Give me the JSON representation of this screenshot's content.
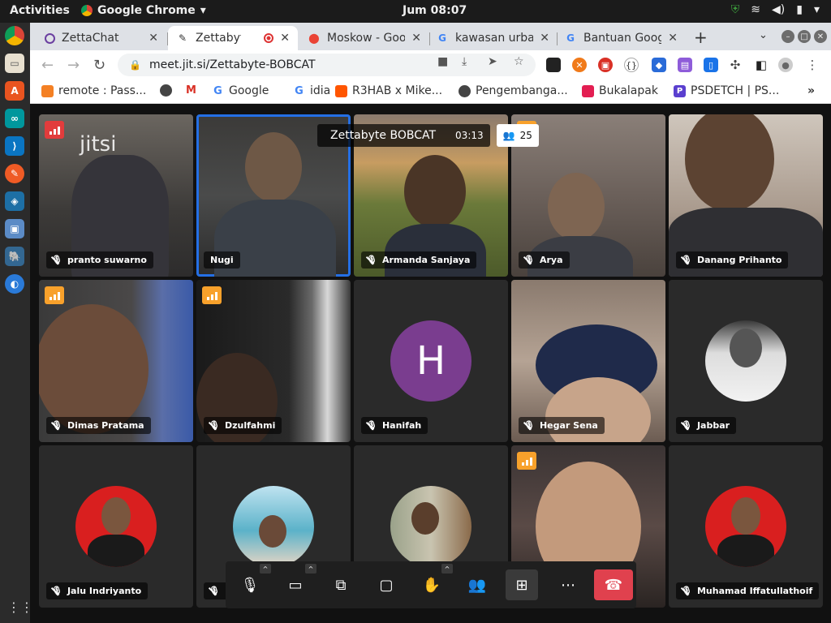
{
  "system": {
    "activities": "Activities",
    "app_name": "Google Chrome",
    "clock": "Jum 08:07"
  },
  "browser": {
    "tabs": [
      {
        "title": "ZettaChat",
        "icon": "circle-notch-icon"
      },
      {
        "title": "Zettabyte-BOBCAT",
        "icon": "jitsi-icon",
        "active": true
      },
      {
        "title": "Moskow - Google Maps",
        "icon": "maps-pin-icon"
      },
      {
        "title": "kawasan urban",
        "icon": "google-icon"
      },
      {
        "title": "Bantuan Google",
        "icon": "google-icon"
      }
    ],
    "url": "meet.jit.si/Zettabyte-BOBCAT",
    "bookmarks": [
      {
        "label": "remote : Pass...",
        "icon": "stack-icon"
      },
      {
        "label": "",
        "icon": "globe-icon"
      },
      {
        "label": "",
        "icon": "gmail-icon"
      },
      {
        "label": "Google",
        "icon": "google-icon"
      },
      {
        "label": "idia",
        "icon": "google-icon"
      },
      {
        "label": "R3HAB x Mike...",
        "icon": "soundcloud-icon"
      },
      {
        "label": "Pengembanga...",
        "icon": "globe-icon"
      },
      {
        "label": "Bukalapak",
        "icon": "bukalapak-icon"
      },
      {
        "label": "PSDETCH | PS...",
        "icon": "ps-icon"
      }
    ],
    "overflow": "»"
  },
  "meeting": {
    "subject": "Zettabyte BOBCAT",
    "timer": "03:13",
    "participant_count": "25",
    "logo": "jitsi",
    "participants": [
      {
        "name": "pranto suwarno",
        "kind": "video"
      },
      {
        "name": "Nugi",
        "kind": "video",
        "active": true
      },
      {
        "name": "Armanda Sanjaya",
        "kind": "video"
      },
      {
        "name": "Arya",
        "kind": "video"
      },
      {
        "name": "Danang Prihanto",
        "kind": "video"
      },
      {
        "name": "Dimas Pratama",
        "kind": "video"
      },
      {
        "name": "Dzulfahmi",
        "kind": "video"
      },
      {
        "name": "Hanifah",
        "kind": "letter",
        "letter": "H"
      },
      {
        "name": "Hegar Sena",
        "kind": "video"
      },
      {
        "name": "Jabbar",
        "kind": "photo"
      },
      {
        "name": "Jalu Indriyanto",
        "kind": "photo"
      },
      {
        "name": "",
        "kind": "photo"
      },
      {
        "name": "",
        "kind": "photo"
      },
      {
        "name": "",
        "kind": "video"
      },
      {
        "name": "Muhamad Iffatullathoif",
        "kind": "photo"
      }
    ]
  },
  "colors": {
    "accent": "#246fe5",
    "hangup": "#e0414e",
    "signal_warn": "#f8a12b",
    "signal_bad": "#e23c3c",
    "avatar_h": "#7a3d8f"
  }
}
